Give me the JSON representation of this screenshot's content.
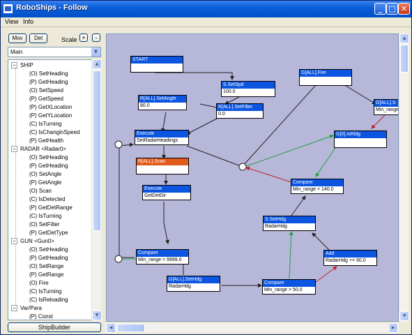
{
  "window": {
    "title": "RoboShips - Follow"
  },
  "menu": {
    "items": [
      "View",
      "Info"
    ]
  },
  "toolbar": {
    "mov_label": "Mov",
    "del_label": "Del",
    "scale_label": "Scale",
    "zoom_in": "+",
    "zoom_out": "-"
  },
  "combo": {
    "selected": "Main"
  },
  "tree": {
    "groups": [
      {
        "label": "SHIP",
        "items": [
          "(O) SetHeading",
          "(P) GetHeading",
          "(O) SetSpeed",
          "(P) GetSpeed",
          "(P) GetXLocation",
          "(P) GetYLocation",
          "(C) IsTurning",
          "(C) IsChanginSpeed",
          "(P) GetHealth"
        ]
      },
      {
        "label": "RADAR <Radar0>",
        "items": [
          "(O) SetHeading",
          "(P) GetHeading",
          "(O) SetAngle",
          "(P) GetAngle",
          "(O) Scan",
          "(C) IsDetected",
          "(P) GetDetRange",
          "(C) IsTurning",
          "(O) SetFilter",
          "(P) GetDetType"
        ]
      },
      {
        "label": "GUN <Gun0>",
        "items": [
          "(O) SetHeading",
          "(P) GetHeading",
          "(O) SetRange",
          "(P) GetRange",
          "(O) Fire",
          "(C) IsTurning",
          "(C) IsReloading"
        ]
      },
      {
        "label": "Var/Para",
        "items": [
          "(P) Const"
        ]
      }
    ]
  },
  "footer": {
    "shipbuilder_label": "ShipBuilder"
  },
  "nodes": [
    {
      "id": "start",
      "header": "START",
      "body": ""
    },
    {
      "id": "setspd",
      "header": "S.SetSpd",
      "body": "100.0"
    },
    {
      "id": "fire",
      "header": "G[ALL].Fire",
      "body": ""
    },
    {
      "id": "gall-s",
      "header": "G[ALL].S",
      "body": "Min_range"
    },
    {
      "id": "setangle",
      "header": "R[ALL].SetAngle",
      "body": "80.0"
    },
    {
      "id": "setfilter",
      "header": "R[ALL].SetFilter",
      "body": "0.0"
    },
    {
      "id": "isrldg",
      "header": "G[0].IsRldg",
      "body": ""
    },
    {
      "id": "exec1",
      "header": "Execute",
      "body": "SetRadarHeadings"
    },
    {
      "id": "scan",
      "header": "R[ALL].Scan",
      "body": ""
    },
    {
      "id": "cmp140",
      "header": "Compare",
      "body": "Min_range < 140.0"
    },
    {
      "id": "exec2",
      "header": "Execute",
      "body": "GetDetDir"
    },
    {
      "id": "shdg",
      "header": "S.SetHdg",
      "body": "RadarHdg"
    },
    {
      "id": "add",
      "header": "Add",
      "body": "RadarHdg += 90.0"
    },
    {
      "id": "cmp9999",
      "header": "Compare",
      "body": "Min_range = 9999.0"
    },
    {
      "id": "gallhdg",
      "header": "G[ALL].SetHdg",
      "body": "RadarHdg"
    },
    {
      "id": "cmp50",
      "header": "Compare",
      "body": "Min_range > 50.0"
    }
  ]
}
